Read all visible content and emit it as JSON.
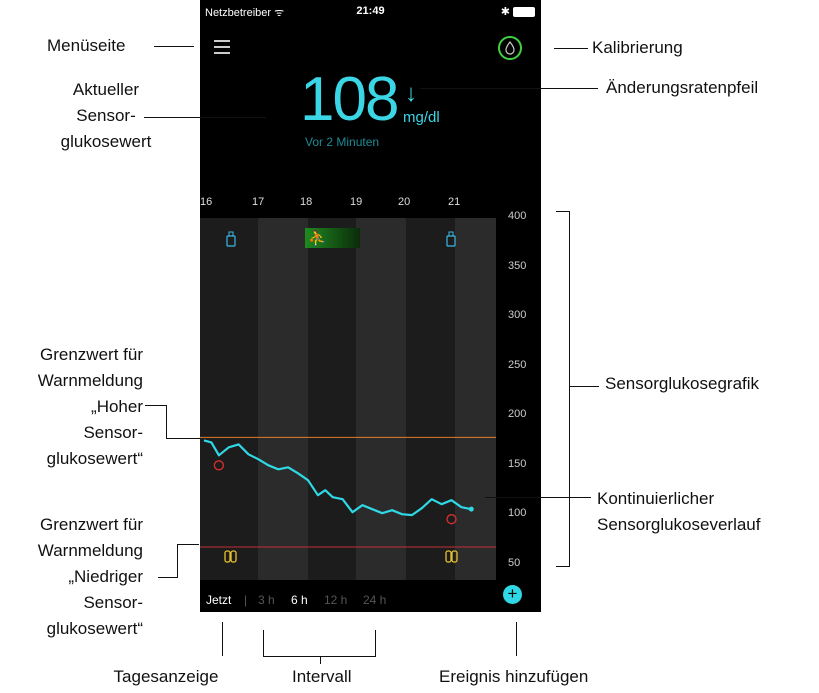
{
  "status": {
    "carrier": "Netzbetreiber ᯤ",
    "time": "21:49",
    "battery": "✱"
  },
  "glucose": {
    "value": "108",
    "arrow": "↓",
    "unit": "mg/dl",
    "ago": "Vor 2 Minuten"
  },
  "hours": [
    "16",
    "17",
    "18",
    "19",
    "20",
    "21"
  ],
  "y_ticks": [
    "400",
    "350",
    "300",
    "250",
    "200",
    "150",
    "100",
    "50"
  ],
  "tabs": {
    "now": "Jetzt",
    "sep": "|",
    "h3": "3 h",
    "h6": "6 h",
    "h12": "12 h",
    "h24": "24 h",
    "add": "+"
  },
  "chart_data": {
    "type": "line",
    "x_label_hours": [
      "16",
      "17",
      "18",
      "19",
      "20",
      "21"
    ],
    "ylim": [
      40,
      400
    ],
    "high_limit": 180,
    "low_limit": 70,
    "series": [
      {
        "values": [
          [
            16.0,
            177
          ],
          [
            16.15,
            175
          ],
          [
            16.3,
            162
          ],
          [
            16.5,
            170
          ],
          [
            16.7,
            173
          ],
          [
            16.9,
            163
          ],
          [
            17.1,
            158
          ],
          [
            17.3,
            152
          ],
          [
            17.5,
            148
          ],
          [
            17.7,
            150
          ],
          [
            17.9,
            144
          ],
          [
            18.1,
            137
          ],
          [
            18.3,
            122
          ],
          [
            18.45,
            127
          ],
          [
            18.6,
            120
          ],
          [
            18.8,
            118
          ],
          [
            19.0,
            105
          ],
          [
            19.2,
            112
          ],
          [
            19.4,
            108
          ],
          [
            19.6,
            104
          ],
          [
            19.8,
            107
          ],
          [
            20.0,
            103
          ],
          [
            20.2,
            102
          ],
          [
            20.4,
            109
          ],
          [
            20.6,
            118
          ],
          [
            20.8,
            113
          ],
          [
            21.0,
            117
          ],
          [
            21.2,
            110
          ],
          [
            21.4,
            108
          ]
        ]
      }
    ],
    "calibration_points": [
      [
        16.3,
        162
      ],
      [
        21.0,
        108
      ]
    ]
  },
  "callouts": {
    "menu": "Menüseite",
    "sensor": "Aktueller\nSensor-\nglukosewert",
    "calibration": "Kalibrierung",
    "rate_arrow": "Änderungsratenpfeil",
    "graph": "Sensorglukosegrafik",
    "high_alert": "Grenzwert für\nWarnmeldung\n„Hoher\nSensor-\nglukosewert“",
    "low_alert": "Grenzwert für\nWarnmeldung\n„Niedriger\nSensor-\nglukosewert“",
    "trace": "Kontinuierlicher\nSensorglukoseverlauf",
    "day": "Tagesanzeige",
    "interval": "Intervall",
    "add_event": "Ereignis hinzufügen"
  }
}
